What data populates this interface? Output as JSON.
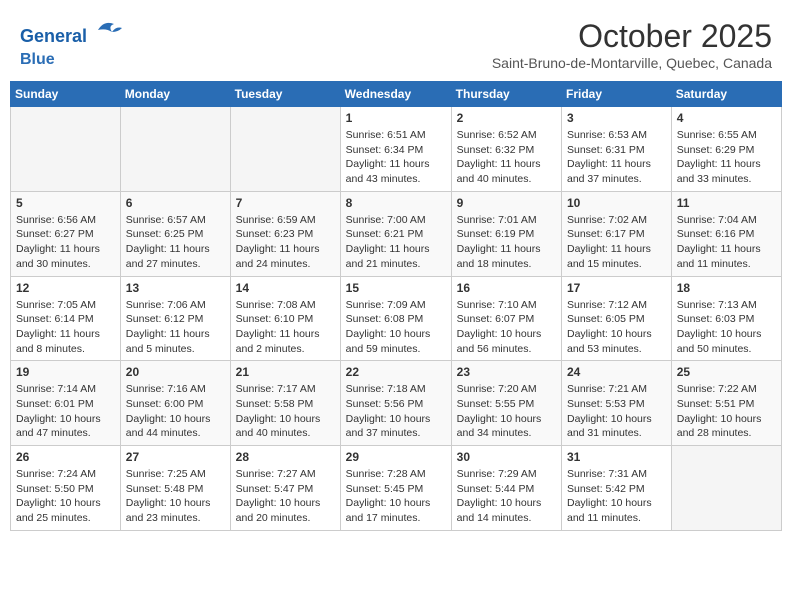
{
  "header": {
    "logo_line1": "General",
    "logo_line2": "Blue",
    "month_title": "October 2025",
    "location": "Saint-Bruno-de-Montarville, Quebec, Canada"
  },
  "days_of_week": [
    "Sunday",
    "Monday",
    "Tuesday",
    "Wednesday",
    "Thursday",
    "Friday",
    "Saturday"
  ],
  "weeks": [
    [
      {
        "day": "",
        "sunrise": "",
        "sunset": "",
        "daylight": ""
      },
      {
        "day": "",
        "sunrise": "",
        "sunset": "",
        "daylight": ""
      },
      {
        "day": "",
        "sunrise": "",
        "sunset": "",
        "daylight": ""
      },
      {
        "day": "1",
        "sunrise": "Sunrise: 6:51 AM",
        "sunset": "Sunset: 6:34 PM",
        "daylight": "Daylight: 11 hours and 43 minutes."
      },
      {
        "day": "2",
        "sunrise": "Sunrise: 6:52 AM",
        "sunset": "Sunset: 6:32 PM",
        "daylight": "Daylight: 11 hours and 40 minutes."
      },
      {
        "day": "3",
        "sunrise": "Sunrise: 6:53 AM",
        "sunset": "Sunset: 6:31 PM",
        "daylight": "Daylight: 11 hours and 37 minutes."
      },
      {
        "day": "4",
        "sunrise": "Sunrise: 6:55 AM",
        "sunset": "Sunset: 6:29 PM",
        "daylight": "Daylight: 11 hours and 33 minutes."
      }
    ],
    [
      {
        "day": "5",
        "sunrise": "Sunrise: 6:56 AM",
        "sunset": "Sunset: 6:27 PM",
        "daylight": "Daylight: 11 hours and 30 minutes."
      },
      {
        "day": "6",
        "sunrise": "Sunrise: 6:57 AM",
        "sunset": "Sunset: 6:25 PM",
        "daylight": "Daylight: 11 hours and 27 minutes."
      },
      {
        "day": "7",
        "sunrise": "Sunrise: 6:59 AM",
        "sunset": "Sunset: 6:23 PM",
        "daylight": "Daylight: 11 hours and 24 minutes."
      },
      {
        "day": "8",
        "sunrise": "Sunrise: 7:00 AM",
        "sunset": "Sunset: 6:21 PM",
        "daylight": "Daylight: 11 hours and 21 minutes."
      },
      {
        "day": "9",
        "sunrise": "Sunrise: 7:01 AM",
        "sunset": "Sunset: 6:19 PM",
        "daylight": "Daylight: 11 hours and 18 minutes."
      },
      {
        "day": "10",
        "sunrise": "Sunrise: 7:02 AM",
        "sunset": "Sunset: 6:17 PM",
        "daylight": "Daylight: 11 hours and 15 minutes."
      },
      {
        "day": "11",
        "sunrise": "Sunrise: 7:04 AM",
        "sunset": "Sunset: 6:16 PM",
        "daylight": "Daylight: 11 hours and 11 minutes."
      }
    ],
    [
      {
        "day": "12",
        "sunrise": "Sunrise: 7:05 AM",
        "sunset": "Sunset: 6:14 PM",
        "daylight": "Daylight: 11 hours and 8 minutes."
      },
      {
        "day": "13",
        "sunrise": "Sunrise: 7:06 AM",
        "sunset": "Sunset: 6:12 PM",
        "daylight": "Daylight: 11 hours and 5 minutes."
      },
      {
        "day": "14",
        "sunrise": "Sunrise: 7:08 AM",
        "sunset": "Sunset: 6:10 PM",
        "daylight": "Daylight: 11 hours and 2 minutes."
      },
      {
        "day": "15",
        "sunrise": "Sunrise: 7:09 AM",
        "sunset": "Sunset: 6:08 PM",
        "daylight": "Daylight: 10 hours and 59 minutes."
      },
      {
        "day": "16",
        "sunrise": "Sunrise: 7:10 AM",
        "sunset": "Sunset: 6:07 PM",
        "daylight": "Daylight: 10 hours and 56 minutes."
      },
      {
        "day": "17",
        "sunrise": "Sunrise: 7:12 AM",
        "sunset": "Sunset: 6:05 PM",
        "daylight": "Daylight: 10 hours and 53 minutes."
      },
      {
        "day": "18",
        "sunrise": "Sunrise: 7:13 AM",
        "sunset": "Sunset: 6:03 PM",
        "daylight": "Daylight: 10 hours and 50 minutes."
      }
    ],
    [
      {
        "day": "19",
        "sunrise": "Sunrise: 7:14 AM",
        "sunset": "Sunset: 6:01 PM",
        "daylight": "Daylight: 10 hours and 47 minutes."
      },
      {
        "day": "20",
        "sunrise": "Sunrise: 7:16 AM",
        "sunset": "Sunset: 6:00 PM",
        "daylight": "Daylight: 10 hours and 44 minutes."
      },
      {
        "day": "21",
        "sunrise": "Sunrise: 7:17 AM",
        "sunset": "Sunset: 5:58 PM",
        "daylight": "Daylight: 10 hours and 40 minutes."
      },
      {
        "day": "22",
        "sunrise": "Sunrise: 7:18 AM",
        "sunset": "Sunset: 5:56 PM",
        "daylight": "Daylight: 10 hours and 37 minutes."
      },
      {
        "day": "23",
        "sunrise": "Sunrise: 7:20 AM",
        "sunset": "Sunset: 5:55 PM",
        "daylight": "Daylight: 10 hours and 34 minutes."
      },
      {
        "day": "24",
        "sunrise": "Sunrise: 7:21 AM",
        "sunset": "Sunset: 5:53 PM",
        "daylight": "Daylight: 10 hours and 31 minutes."
      },
      {
        "day": "25",
        "sunrise": "Sunrise: 7:22 AM",
        "sunset": "Sunset: 5:51 PM",
        "daylight": "Daylight: 10 hours and 28 minutes."
      }
    ],
    [
      {
        "day": "26",
        "sunrise": "Sunrise: 7:24 AM",
        "sunset": "Sunset: 5:50 PM",
        "daylight": "Daylight: 10 hours and 25 minutes."
      },
      {
        "day": "27",
        "sunrise": "Sunrise: 7:25 AM",
        "sunset": "Sunset: 5:48 PM",
        "daylight": "Daylight: 10 hours and 23 minutes."
      },
      {
        "day": "28",
        "sunrise": "Sunrise: 7:27 AM",
        "sunset": "Sunset: 5:47 PM",
        "daylight": "Daylight: 10 hours and 20 minutes."
      },
      {
        "day": "29",
        "sunrise": "Sunrise: 7:28 AM",
        "sunset": "Sunset: 5:45 PM",
        "daylight": "Daylight: 10 hours and 17 minutes."
      },
      {
        "day": "30",
        "sunrise": "Sunrise: 7:29 AM",
        "sunset": "Sunset: 5:44 PM",
        "daylight": "Daylight: 10 hours and 14 minutes."
      },
      {
        "day": "31",
        "sunrise": "Sunrise: 7:31 AM",
        "sunset": "Sunset: 5:42 PM",
        "daylight": "Daylight: 10 hours and 11 minutes."
      },
      {
        "day": "",
        "sunrise": "",
        "sunset": "",
        "daylight": ""
      }
    ]
  ]
}
